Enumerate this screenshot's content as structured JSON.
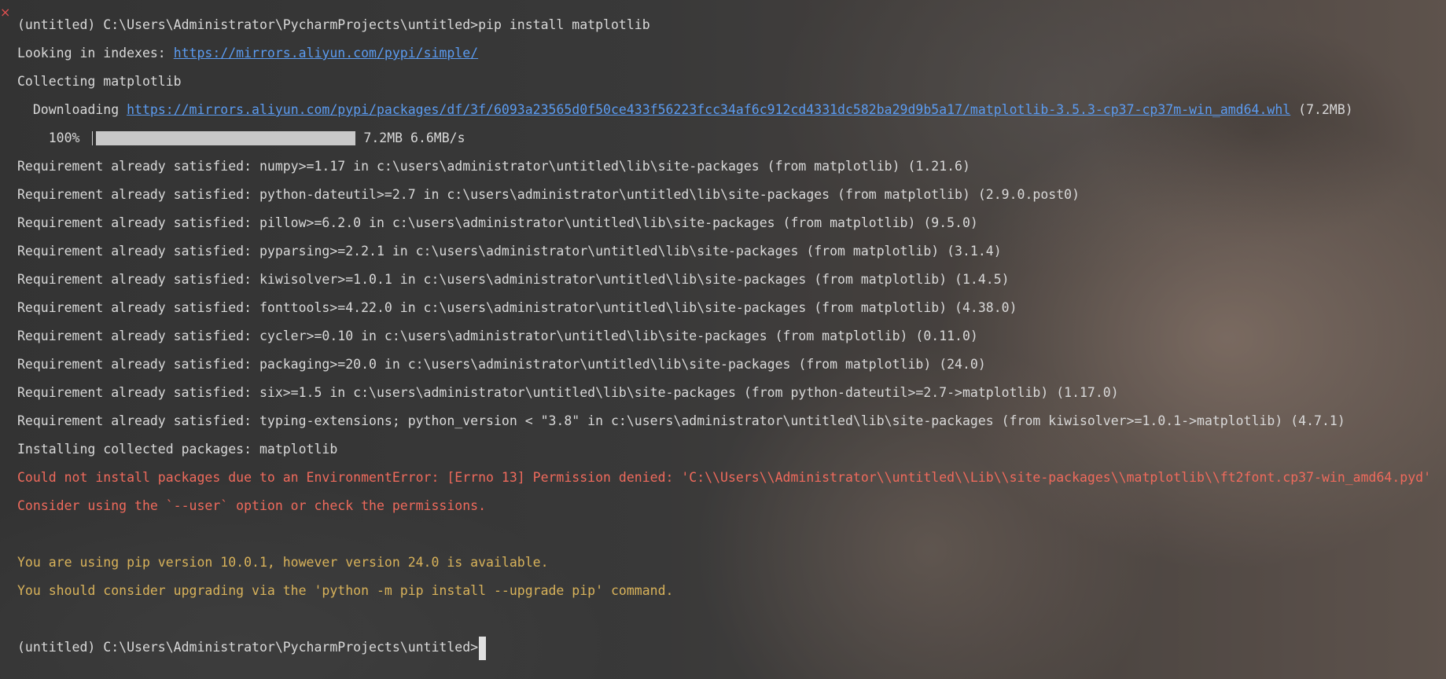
{
  "close_glyph": "×",
  "lines": {
    "l1": "(untitled) C:\\Users\\Administrator\\PycharmProjects\\untitled>pip install matplotlib",
    "l2_prefix": "Looking in indexes: ",
    "l2_link": "https://mirrors.aliyun.com/pypi/simple/",
    "l3": "Collecting matplotlib",
    "l4_prefix": "  Downloading ",
    "l4_link": "https://mirrors.aliyun.com/pypi/packages/df/3f/6093a23565d0f50ce433f56223fcc34af6c912cd4331dc582ba29d9b5a17/matplotlib-3.5.3-cp37-cp37m-win_amd64.whl",
    "l4_suffix": " (7.2MB)",
    "progress_percent_label": "    100% ",
    "progress_fraction": 1.0,
    "progress_stats": "7.2MB 6.6MB/s",
    "l6": "Requirement already satisfied: numpy>=1.17 in c:\\users\\administrator\\untitled\\lib\\site-packages (from matplotlib) (1.21.6)",
    "l7": "Requirement already satisfied: python-dateutil>=2.7 in c:\\users\\administrator\\untitled\\lib\\site-packages (from matplotlib) (2.9.0.post0)",
    "l8": "Requirement already satisfied: pillow>=6.2.0 in c:\\users\\administrator\\untitled\\lib\\site-packages (from matplotlib) (9.5.0)",
    "l9": "Requirement already satisfied: pyparsing>=2.2.1 in c:\\users\\administrator\\untitled\\lib\\site-packages (from matplotlib) (3.1.4)",
    "l10": "Requirement already satisfied: kiwisolver>=1.0.1 in c:\\users\\administrator\\untitled\\lib\\site-packages (from matplotlib) (1.4.5)",
    "l11": "Requirement already satisfied: fonttools>=4.22.0 in c:\\users\\administrator\\untitled\\lib\\site-packages (from matplotlib) (4.38.0)",
    "l12": "Requirement already satisfied: cycler>=0.10 in c:\\users\\administrator\\untitled\\lib\\site-packages (from matplotlib) (0.11.0)",
    "l13": "Requirement already satisfied: packaging>=20.0 in c:\\users\\administrator\\untitled\\lib\\site-packages (from matplotlib) (24.0)",
    "l14": "Requirement already satisfied: six>=1.5 in c:\\users\\administrator\\untitled\\lib\\site-packages (from python-dateutil>=2.7->matplotlib) (1.17.0)",
    "l15": "Requirement already satisfied: typing-extensions; python_version < \"3.8\" in c:\\users\\administrator\\untitled\\lib\\site-packages (from kiwisolver>=1.0.1->matplotlib) (4.7.1)",
    "l16": "Installing collected packages: matplotlib",
    "l17": "Could not install packages due to an EnvironmentError: [Errno 13] Permission denied: 'C:\\\\Users\\\\Administrator\\\\untitled\\\\Lib\\\\site-packages\\\\matplotlib\\\\ft2font.cp37-win_amd64.pyd'",
    "l18": "Consider using the `--user` option or check the permissions.",
    "l20": "You are using pip version 10.0.1, however version 24.0 is available.",
    "l21": "You should consider upgrading via the 'python -m pip install --upgrade pip' command.",
    "l23": "(untitled) C:\\Users\\Administrator\\PycharmProjects\\untitled>"
  },
  "colors": {
    "text": "#d9d9d9",
    "link": "#5b9bf0",
    "error": "#ef6a5c",
    "warning": "#d8b25a"
  }
}
